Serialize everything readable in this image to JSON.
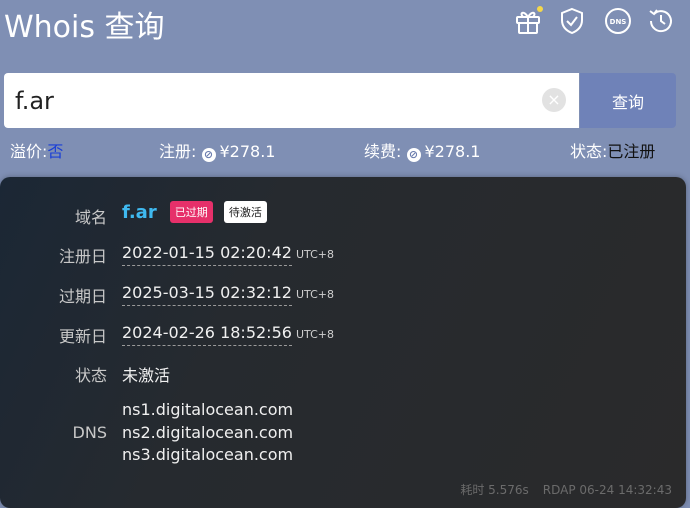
{
  "header": {
    "title": "Whois 查询",
    "icons": [
      "gift-icon",
      "shield-check-icon",
      "dns-icon",
      "history-icon"
    ],
    "dns_icon_text": "DNS"
  },
  "search": {
    "value": "f.ar",
    "clear_symbol": "×",
    "button_label": "查询"
  },
  "info_bar": {
    "premium_label": "溢价:",
    "premium_value": "否",
    "register_label": "注册:",
    "register_price": "¥278.1",
    "renew_label": "续费:",
    "renew_price": "¥278.1",
    "status_label": "状态:",
    "status_value": "已注册"
  },
  "result": {
    "domain_label": "域名",
    "domain": "f.ar",
    "badges": [
      "已过期",
      "待激活"
    ],
    "registered_label": "注册日",
    "registered_date": "2022-01-15 02:20:42",
    "expiry_label": "过期日",
    "expiry_date": "2025-03-15 02:32:12",
    "updated_label": "更新日",
    "updated_date": "2024-02-26 18:52:56",
    "timezone": "UTC+8",
    "status_label": "状态",
    "status_value": "未激活",
    "dns_label": "DNS",
    "nameservers": [
      "ns1.digitalocean.com",
      "ns2.digitalocean.com",
      "ns3.digitalocean.com"
    ],
    "elapsed": "耗时 5.576s",
    "source": "RDAP 06-24 14:32:43"
  },
  "colors": {
    "header_bg": "#7f8fb4",
    "button_bg": "#6f82b8",
    "card_bg": "#2a2a2b",
    "domain_accent": "#3fb9f0",
    "expired_badge": "#e6306a",
    "link_blue": "#1a3fd6"
  }
}
